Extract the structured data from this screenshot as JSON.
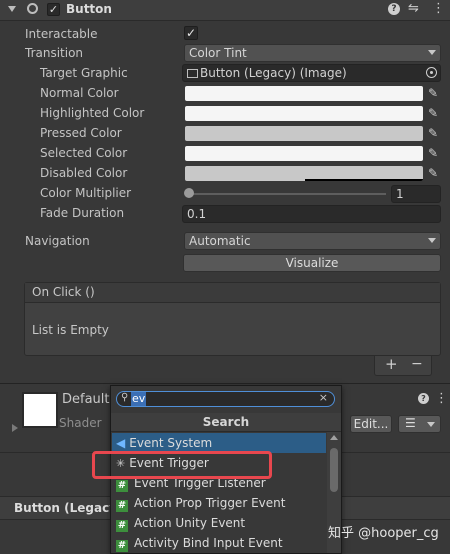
{
  "component": {
    "title": "Button"
  },
  "labels": {
    "interactable": "Interactable",
    "transition": "Transition",
    "target_graphic": "Target Graphic",
    "normal_color": "Normal Color",
    "highlighted_color": "Highlighted Color",
    "pressed_color": "Pressed Color",
    "selected_color": "Selected Color",
    "disabled_color": "Disabled Color",
    "color_multiplier": "Color Multiplier",
    "fade_duration": "Fade Duration",
    "navigation": "Navigation"
  },
  "values": {
    "interactable_checked": true,
    "transition": "Color Tint",
    "target_graphic": "Button (Legacy) (Image)",
    "color_multiplier": "1",
    "color_multiplier_fraction": 0.0,
    "fade_duration": "0.1",
    "navigation": "Automatic"
  },
  "colors": {
    "normal": "#ffffff",
    "highlighted": "#f5f5f5",
    "pressed": "#c8c8c8",
    "selected": "#f5f5f5",
    "disabled": "#c8c8c8",
    "disabled_alpha": 0.5
  },
  "visualize_label": "Visualize",
  "onclick": {
    "header": "On Click ()",
    "empty_text": "List is Empty",
    "add_label": "+",
    "remove_label": "−"
  },
  "material": {
    "name": "Default",
    "shader_label": "Shader",
    "edit_label": "Edit..."
  },
  "search": {
    "query": "ev",
    "title": "Search",
    "results": [
      {
        "label": "Event System",
        "icon": "event-system-icon",
        "selected": true
      },
      {
        "label": "Event Trigger",
        "icon": "event-trigger-icon",
        "highlighted": true
      },
      {
        "label": "Event Trigger Listener",
        "icon": "script-icon"
      },
      {
        "label": "Action Prop Trigger Event",
        "icon": "script-icon"
      },
      {
        "label": "Action Unity Event",
        "icon": "script-icon"
      },
      {
        "label": "Activity Bind Input Event",
        "icon": "script-icon"
      }
    ]
  },
  "bottom_component": {
    "title": "Button (Legacy)"
  },
  "watermark": "知乎 @hooper_cg"
}
